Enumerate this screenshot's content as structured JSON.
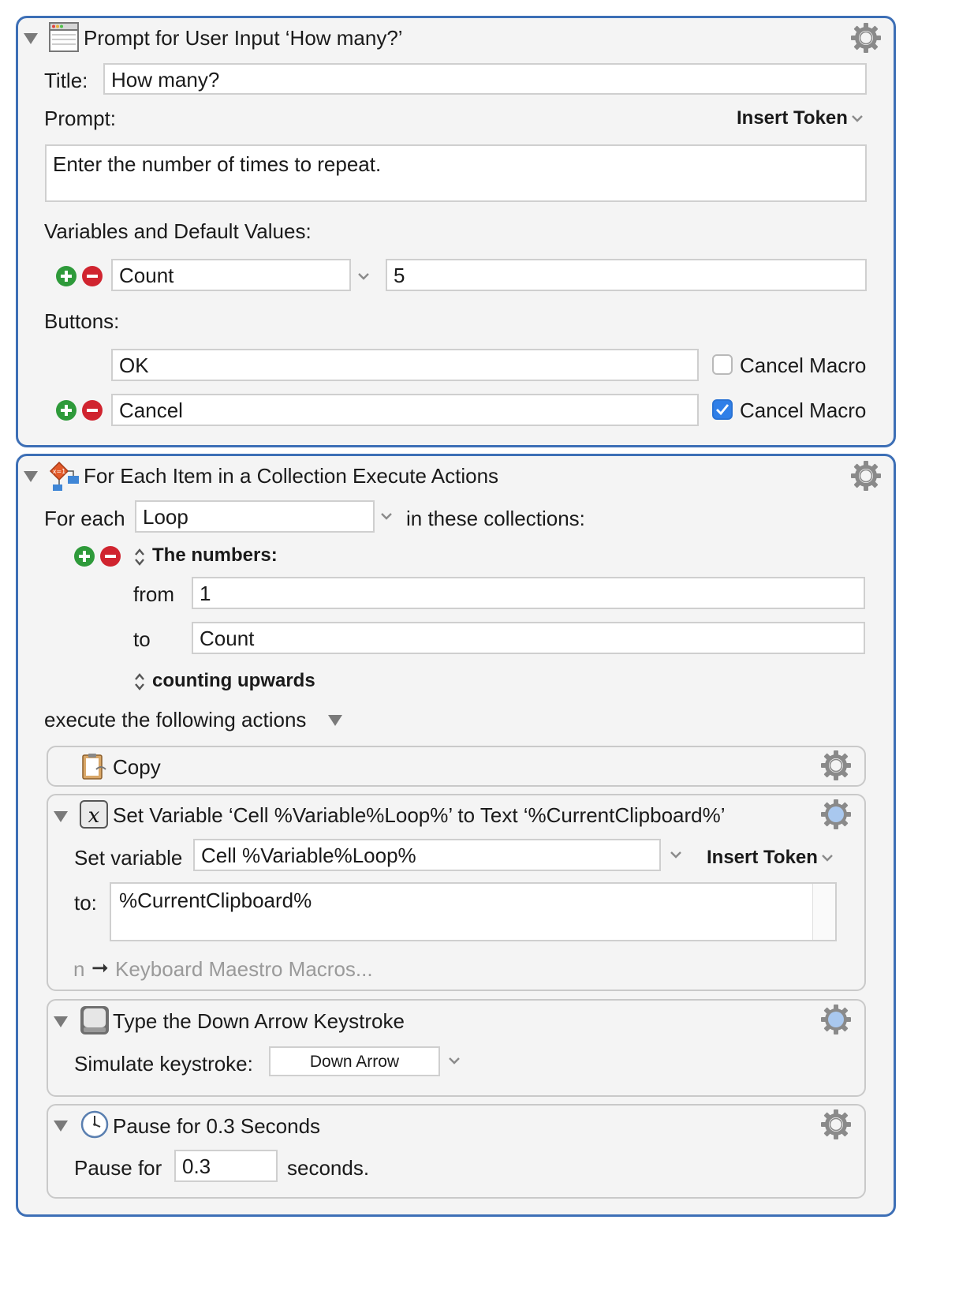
{
  "prompt_action": {
    "title": "Prompt for User Input ‘How many?’",
    "title_label": "Title:",
    "title_value": "How many?",
    "prompt_label": "Prompt:",
    "insert_token": "Insert Token",
    "prompt_text": "Enter the number of times to repeat.",
    "variables_label": "Variables and Default Values:",
    "variable_name": "Count",
    "variable_default": "5",
    "buttons_label": "Buttons:",
    "buttons": [
      {
        "label": "OK",
        "cancel_text": "Cancel Macro",
        "cancel_checked": false
      },
      {
        "label": "Cancel",
        "cancel_text": "Cancel Macro",
        "cancel_checked": true
      }
    ]
  },
  "foreach_action": {
    "title": "For Each Item in a Collection Execute Actions",
    "for_each_label": "For each",
    "loop_variable": "Loop",
    "in_collections_label": "in these collections:",
    "collection_type": "The numbers:",
    "from_label": "from",
    "from_value": "1",
    "to_label": "to",
    "to_value": "Count",
    "direction": "counting upwards",
    "execute_label": "execute the following actions",
    "copy_action": {
      "title": "Copy"
    },
    "set_variable_action": {
      "title": "Set Variable ‘Cell %Variable%Loop%’ to Text ‘%CurrentClipboard%’",
      "set_variable_label": "Set variable",
      "variable_value": "Cell %Variable%Loop%",
      "insert_token": "Insert Token",
      "to_label": "to:",
      "text_value": "%CurrentClipboard%",
      "hint_prefix": "n",
      "hint_arrow": "➞",
      "hint_text": "Keyboard Maestro Macros..."
    },
    "keystroke_action": {
      "title": "Type the Down Arrow Keystroke",
      "simulate_label": "Simulate keystroke:",
      "key_value": "Down Arrow"
    },
    "pause_action": {
      "title": "Pause for 0.3 Seconds",
      "pause_for_label": "Pause for",
      "pause_value": "0.3",
      "seconds_label": "seconds."
    }
  },
  "colors": {
    "panel_border": "#3d6fb6",
    "add_green": "#2e9a3a",
    "remove_red": "#d0242f",
    "checkbox_blue": "#2f7fe8"
  }
}
